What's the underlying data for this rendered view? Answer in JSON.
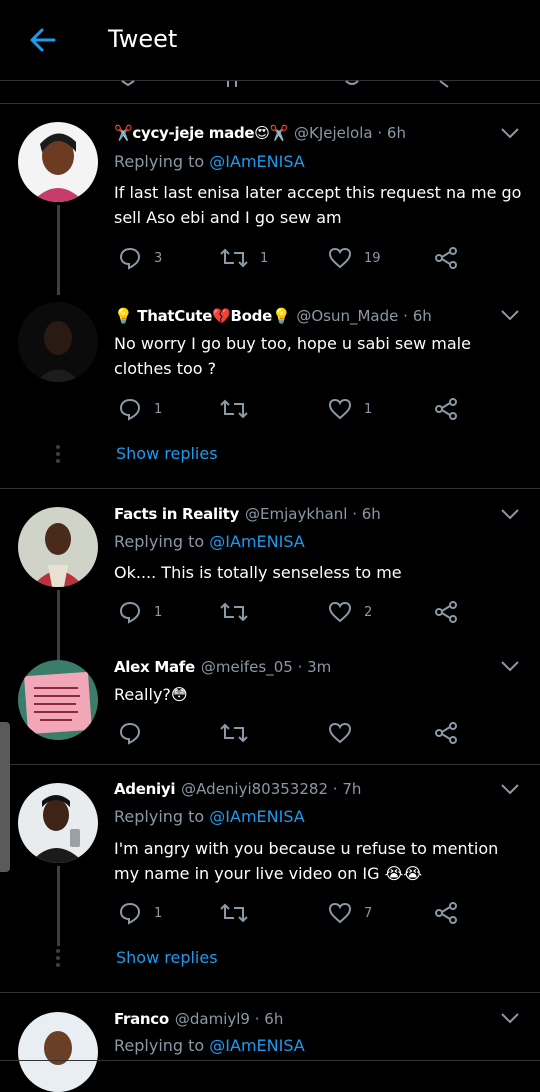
{
  "header": {
    "title": "Tweet"
  },
  "replying_label": "Replying to",
  "show_replies_label": "Show replies",
  "accent": "#1d9bf0",
  "tweets": [
    {
      "name": "✂️cycy-jeje made😍✂️",
      "handle": "@KJejelola",
      "time": "· 6h",
      "replying_to": "@IAmENISA",
      "text": "If last last enisa later accept this request na me go sell Aso ebi and I go sew am",
      "replies": "3",
      "retweets": "1",
      "likes": "19"
    },
    {
      "name": "💡 ThatCute💔Bode💡",
      "handle": "@Osun_Made",
      "time": "· 6h",
      "text": "No worry I go buy too, hope u sabi sew male clothes too ?",
      "replies": "1",
      "retweets": "",
      "likes": "1"
    },
    {
      "name": "Facts in Reality",
      "handle": "@Emjaykhanl",
      "time": "· 6h",
      "replying_to": "@IAmENISA",
      "text": "Ok.... This is totally senseless to me",
      "replies": "1",
      "retweets": "",
      "likes": "2"
    },
    {
      "name": "Alex Mafe",
      "handle": "@meifes_05",
      "time": "· 3m",
      "text": "Really?😳",
      "replies": "",
      "retweets": "",
      "likes": ""
    },
    {
      "name": "Adeniyi",
      "handle": "@Adeniyi80353282",
      "time": "· 7h",
      "replying_to": "@IAmENISA",
      "text": "I'm angry with you because u refuse to mention my name in your live video on IG 😭😭",
      "replies": "1",
      "retweets": "",
      "likes": "7"
    },
    {
      "name": "Franco",
      "handle": "@damiyl9",
      "time": "· 6h",
      "replying_to": "@IAmENISA"
    }
  ],
  "icons": [
    "back-arrow-icon",
    "chevron-down-icon",
    "reply-icon",
    "retweet-icon",
    "like-icon",
    "share-icon"
  ]
}
